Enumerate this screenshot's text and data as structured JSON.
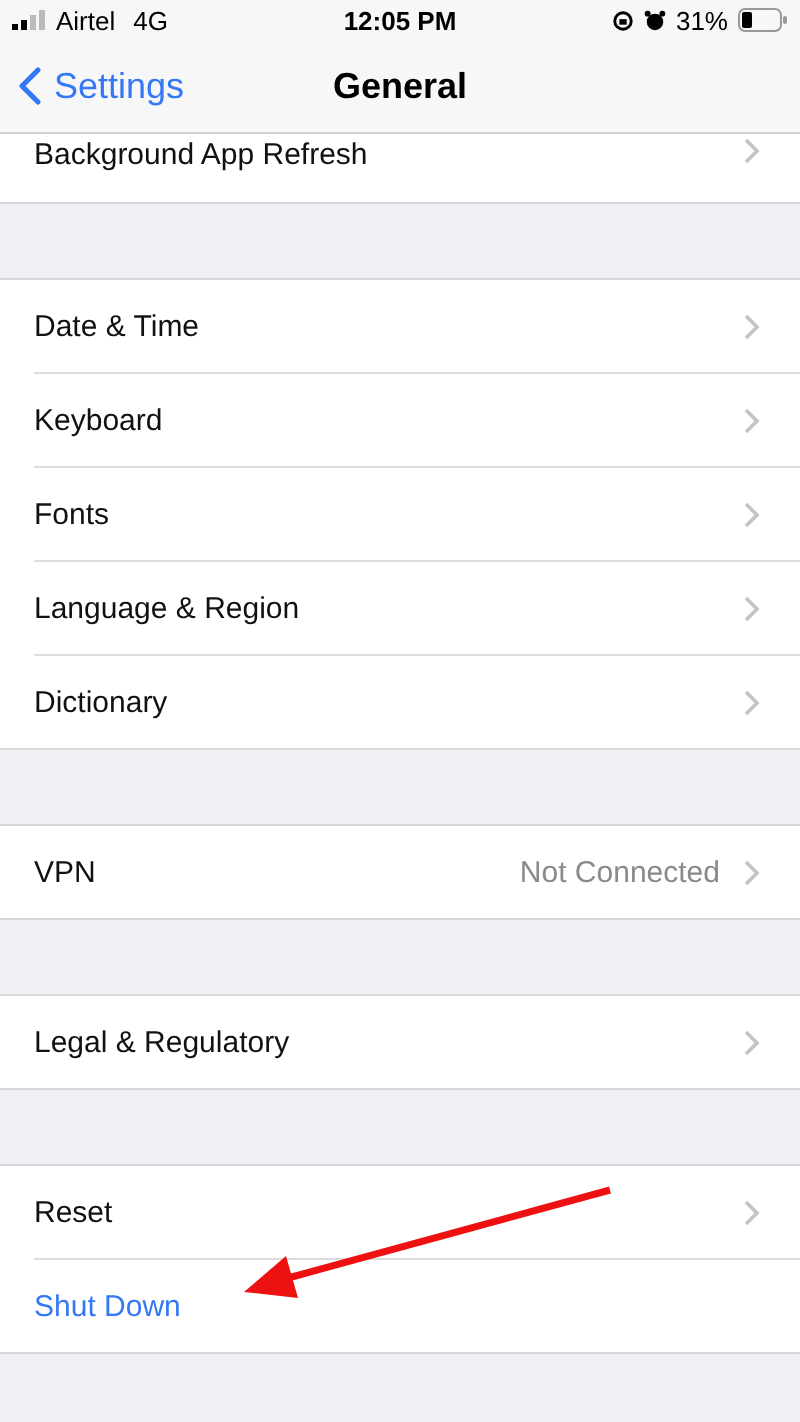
{
  "status_bar": {
    "carrier": "Airtel",
    "network": "4G",
    "time": "12:05 PM",
    "battery": "31%"
  },
  "nav": {
    "back": "Settings",
    "title": "General"
  },
  "groups": [
    {
      "cut_off": true,
      "rows": [
        {
          "kind": "link",
          "label": "Background App Refresh"
        }
      ]
    },
    {
      "cut_off": false,
      "rows": [
        {
          "kind": "link",
          "label": "Date & Time"
        },
        {
          "kind": "link",
          "label": "Keyboard"
        },
        {
          "kind": "link",
          "label": "Fonts"
        },
        {
          "kind": "link",
          "label": "Language & Region"
        },
        {
          "kind": "link",
          "label": "Dictionary"
        }
      ]
    },
    {
      "cut_off": false,
      "rows": [
        {
          "kind": "link",
          "label": "VPN",
          "value": "Not Connected"
        }
      ]
    },
    {
      "cut_off": false,
      "rows": [
        {
          "kind": "link",
          "label": "Legal & Regulatory"
        }
      ]
    },
    {
      "cut_off": false,
      "rows": [
        {
          "kind": "link",
          "label": "Reset"
        },
        {
          "kind": "action",
          "label": "Shut Down"
        }
      ]
    }
  ]
}
